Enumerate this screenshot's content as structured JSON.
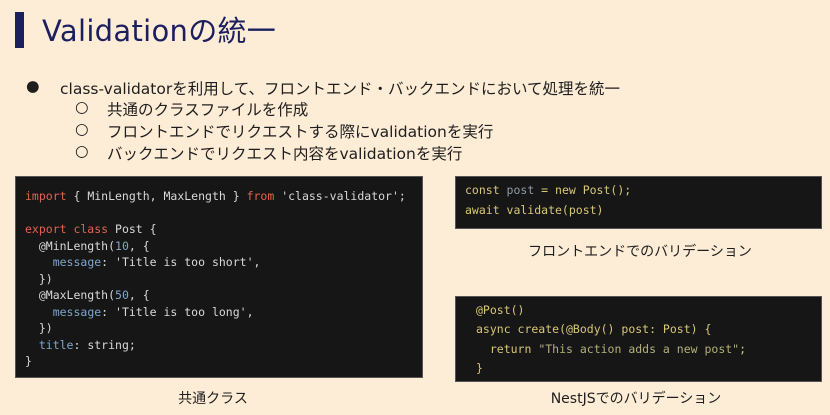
{
  "title": "Validationの統一",
  "bullets": {
    "main": "class-validatorを利用して、フロントエンド・バックエンドにおいて処理を統一",
    "sub": [
      "共通のクラスファイルを作成",
      "フロントエンドでリクエストする際にvalidationを実行",
      "バックエンドでリクエスト内容をvalidationを実行"
    ]
  },
  "code_common": [
    [
      "import",
      " { MinLength, MaxLength } ",
      "from",
      " 'class-validator';"
    ],
    [
      "export class",
      " Post {"
    ],
    [
      "  @MinLength(",
      "10",
      ", {"
    ],
    [
      "    ",
      "message",
      ": 'Title is too short',"
    ],
    [
      "  })"
    ],
    [
      "  @MaxLength(",
      "50",
      ", {"
    ],
    [
      "    ",
      "message",
      ": 'Title is too long',"
    ],
    [
      "  })"
    ],
    [
      "  ",
      "title",
      ": string;"
    ],
    [
      "}"
    ]
  ],
  "code_front": [
    [
      "const ",
      "post",
      " = new Post();"
    ],
    [
      "await validate(post)"
    ]
  ],
  "code_back": [
    [
      "@Post()"
    ],
    [
      "async create(@Body() post: Post) {"
    ],
    [
      "  return ",
      "\"This action adds a new post\"",
      ";"
    ],
    [
      "}"
    ]
  ],
  "captions": {
    "common": "共通クラス",
    "front": "フロントエンドでのバリデーション",
    "back": "NestJSでのバリデーション"
  },
  "colors": {
    "background": "#fdecd6",
    "title": "#1b1f5e",
    "code_bg": "#161616"
  }
}
